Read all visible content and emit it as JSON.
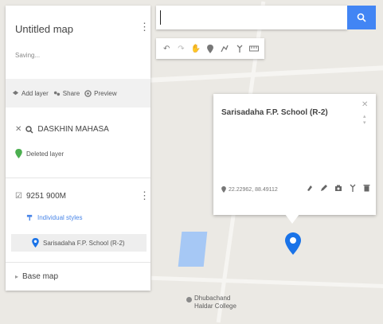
{
  "map": {
    "title": "Untitled map",
    "status": "Saving...",
    "add_layer_label": "Add layer",
    "share_label": "Share",
    "preview_label": "Preview"
  },
  "layer1": {
    "name": "DASKHIN MAHASA",
    "item": "Deleted layer"
  },
  "layer2": {
    "name": "9251 900M",
    "style_link": "Individual styles",
    "item": "Sarisadaha F.P. School (R-2)"
  },
  "basemap": {
    "label": "Base map"
  },
  "search": {
    "value": "",
    "placeholder": ""
  },
  "toolbar": {
    "tools": [
      "undo-icon",
      "redo-icon",
      "hand-icon",
      "marker-icon",
      "draw-line-icon",
      "directions-icon",
      "ruler-icon"
    ]
  },
  "popup": {
    "title": "Sarisadaha F.P. School (R-2)",
    "coords": "22.22962, 88.49112"
  },
  "poi": {
    "line1": "Dhubachand",
    "line2": "Haldar College"
  },
  "colors": {
    "accent": "#4285f4",
    "marker": "#1a73e8",
    "water": "#a6c8f5",
    "green": "#4caf50"
  }
}
